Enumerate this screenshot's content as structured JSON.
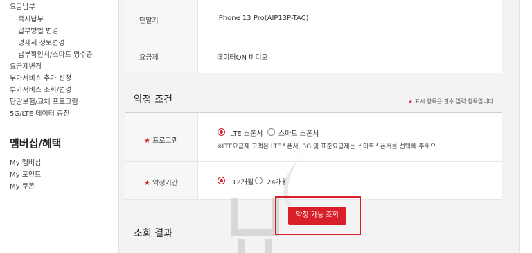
{
  "sidebar": {
    "items": [
      {
        "label": "요금납부"
      },
      {
        "label": "즉시납부"
      },
      {
        "label": "납부방법 변경"
      },
      {
        "label": "명세서 정보변경"
      },
      {
        "label": "납부확인서/스마트 영수증"
      },
      {
        "label": "요금제변경"
      },
      {
        "label": "부가서비스 추가 신청"
      },
      {
        "label": "부가서비스 조회/변경"
      },
      {
        "label": "단말보험/교체 프로그램"
      },
      {
        "label": "5G/LTE 데이터 충전"
      }
    ],
    "heading": "멤버십/혜택",
    "membership_items": [
      {
        "label": "My 멤버십"
      },
      {
        "label": "My 포인트"
      },
      {
        "label": "My 쿠폰"
      }
    ]
  },
  "device": {
    "label": "단말기",
    "value": "iPhone 13 Pro(AIP13P-TAC)"
  },
  "plan": {
    "label": "요금제",
    "value": "데이터ON 비디오"
  },
  "contract": {
    "title": "약정 조건",
    "required_note": "표시 항목은 필수 입력 항목입니다.",
    "required_star": "★",
    "program": {
      "label": "프로그램",
      "options": [
        {
          "label": "LTE 스폰서",
          "selected": true
        },
        {
          "label": "스마트 스폰서",
          "selected": false
        }
      ],
      "note": "※LTE요금제 고객은 LTE스폰서, 3G 및 표준요금제는 스마트스폰서를 선택해 주세요."
    },
    "period": {
      "label": "약정기간",
      "options": [
        {
          "label": "12개월",
          "selected": true
        },
        {
          "label": "24개월",
          "selected": false
        }
      ]
    },
    "check_button": "약정 가능 조회"
  },
  "result": {
    "title": "조회 결과"
  },
  "colors": {
    "accent": "#d9202a",
    "panel_bg": "#f3f3f3",
    "label_bg": "#f7f7f7"
  }
}
